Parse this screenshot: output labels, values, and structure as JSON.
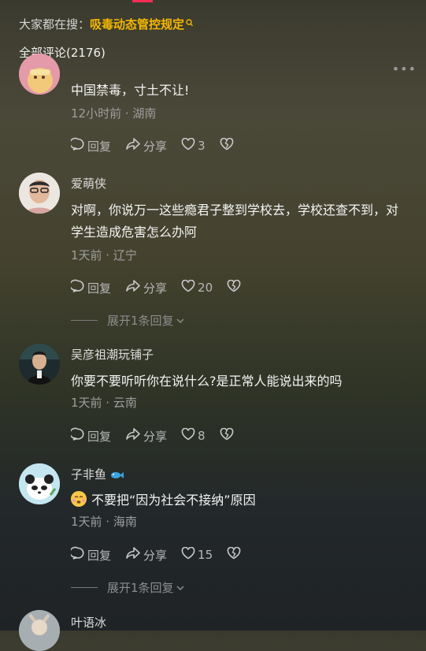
{
  "header": {
    "search_prefix": "大家都在搜：",
    "search_query": "吸毒动态管控规定",
    "comments_count_label": "全部评论(2176)"
  },
  "more_label": "•••",
  "action_labels": {
    "reply": "回复",
    "share": "分享"
  },
  "comments": [
    {
      "username": "",
      "text": "中国禁毒，寸土不让!",
      "meta": "12小时前 · 湖南",
      "likes": "3"
    },
    {
      "username": "爱萌侠",
      "text": "对啊，你说万一这些瘾君子整到学校去，学校还查不到，对学生造成危害怎么办阿",
      "meta": "1天前 · 辽宁",
      "likes": "20",
      "expand": "展开1条回复"
    },
    {
      "username": "吴彦祖潮玩铺子",
      "text": "你要不要听听你在说什么?是正常人能说出来的吗",
      "meta": "1天前 · 云南",
      "likes": "8"
    },
    {
      "username": "子非鱼",
      "text": "不要把“因为社会不接纳”原因",
      "meta": "1天前 · 海南",
      "likes": "15",
      "expand": "展开1条回复"
    },
    {
      "username": "叶语冰"
    }
  ],
  "colors": {
    "accent": "#f5b800",
    "brand_red": "#ff2c55"
  }
}
